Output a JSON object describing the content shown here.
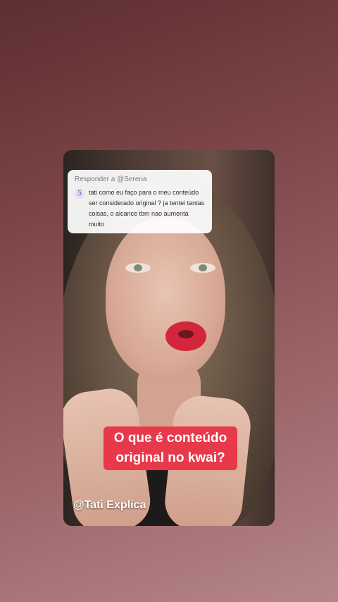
{
  "reply_sticker": {
    "title": "Responder a @Serena",
    "avatar_text": "5",
    "comment": "tati como eu faço para o meu conteúdo ser considerado original ? ja tentei tantas coisas, o alcance tbm nao aumenta muito"
  },
  "caption": "O que é conteúdo original no kwai?",
  "watermark": "@Tati Explica",
  "colors": {
    "caption_bg": "#e8394a",
    "background": "#8a5456"
  }
}
